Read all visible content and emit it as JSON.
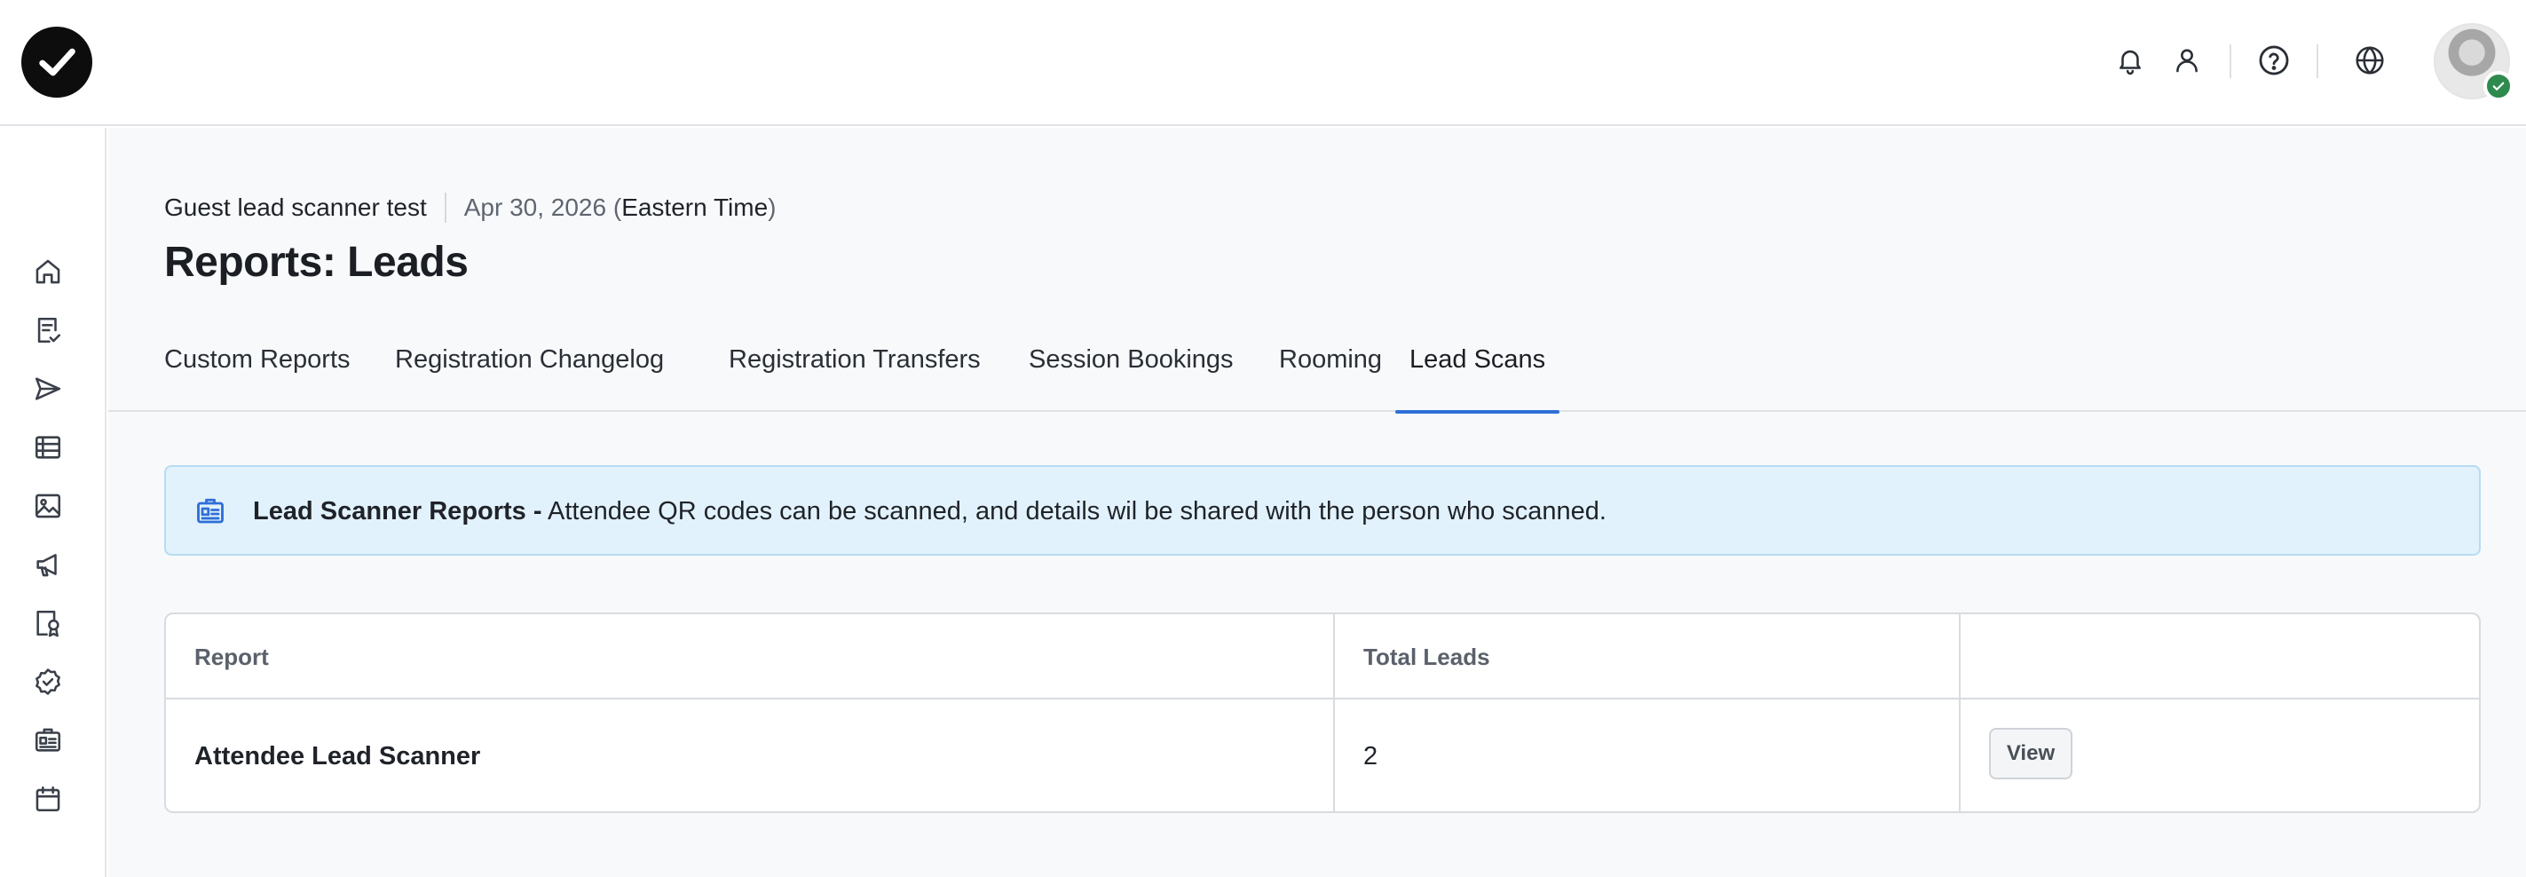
{
  "header": {
    "logo_icon": "check-circle-logo-icon",
    "icons": [
      "bell-icon",
      "user-icon",
      "help-circle-icon",
      "globe-icon"
    ],
    "avatar_badge_icon": "shield-check-icon",
    "colors": {
      "logo": "#0d0d0d",
      "badge": "#2e8a4d"
    }
  },
  "sidebar": {
    "items": [
      {
        "icon": "home-icon"
      },
      {
        "icon": "form-check-icon"
      },
      {
        "icon": "send-icon"
      },
      {
        "icon": "list-icon"
      },
      {
        "icon": "image-icon"
      },
      {
        "icon": "megaphone-icon"
      },
      {
        "icon": "certificate-icon"
      },
      {
        "icon": "badge-check-icon"
      },
      {
        "icon": "id-card-icon"
      },
      {
        "icon": "calendar-icon"
      }
    ]
  },
  "breadcrumb": {
    "event_name": "Guest lead scanner test",
    "date": "Apr 30, 2026 (",
    "timezone": "Eastern Time",
    "close_paren": ")"
  },
  "page": {
    "title": "Reports: Leads"
  },
  "tabs": [
    {
      "label": "Custom Reports"
    },
    {
      "label": "Registration Changelog"
    },
    {
      "label": "Registration Transfers"
    },
    {
      "label": "Session Bookings"
    },
    {
      "label": "Rooming"
    },
    {
      "label": "Lead Scans",
      "active": true
    }
  ],
  "banner": {
    "icon": "id-card-icon",
    "title": "Lead Scanner Reports -",
    "message": " Attendee QR codes can be scanned, and details wil be shared with the person who scanned.",
    "colors": {
      "background": "#e2f2fc",
      "border": "#b6dcf2",
      "icon": "#2f6fd6"
    }
  },
  "table": {
    "columns": [
      "Report",
      "Total Leads",
      ""
    ],
    "rows": [
      {
        "report": "Attendee Lead Scanner",
        "total_leads": "2",
        "action_label": "View"
      }
    ]
  },
  "theme": {
    "accent": "#2f6fd6"
  }
}
